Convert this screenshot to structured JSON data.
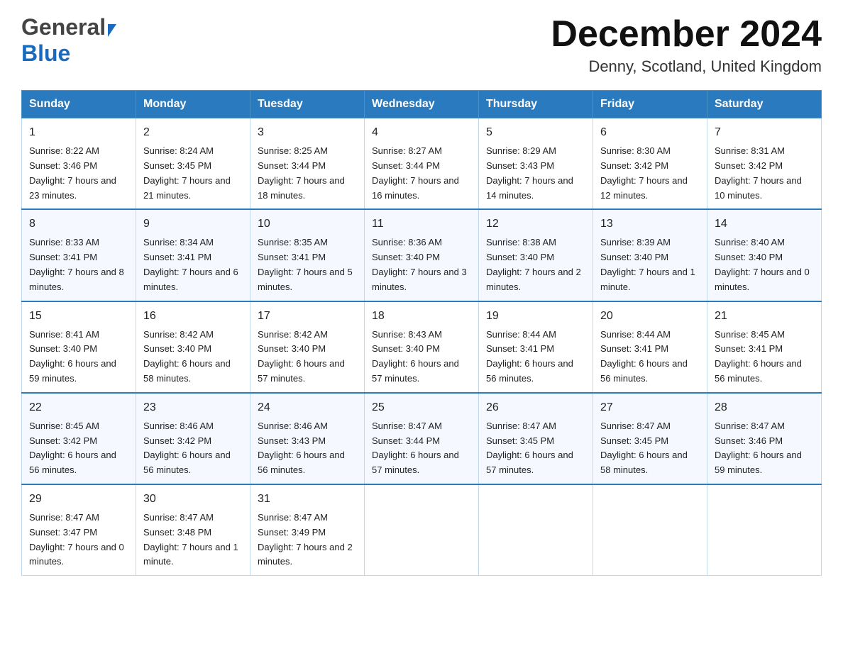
{
  "header": {
    "logo_general": "General",
    "logo_blue": "Blue",
    "title": "December 2024",
    "subtitle": "Denny, Scotland, United Kingdom"
  },
  "days_of_week": [
    "Sunday",
    "Monday",
    "Tuesday",
    "Wednesday",
    "Thursday",
    "Friday",
    "Saturday"
  ],
  "weeks": [
    [
      {
        "day": "1",
        "sunrise": "8:22 AM",
        "sunset": "3:46 PM",
        "daylight": "7 hours and 23 minutes."
      },
      {
        "day": "2",
        "sunrise": "8:24 AM",
        "sunset": "3:45 PM",
        "daylight": "7 hours and 21 minutes."
      },
      {
        "day": "3",
        "sunrise": "8:25 AM",
        "sunset": "3:44 PM",
        "daylight": "7 hours and 18 minutes."
      },
      {
        "day": "4",
        "sunrise": "8:27 AM",
        "sunset": "3:44 PM",
        "daylight": "7 hours and 16 minutes."
      },
      {
        "day": "5",
        "sunrise": "8:29 AM",
        "sunset": "3:43 PM",
        "daylight": "7 hours and 14 minutes."
      },
      {
        "day": "6",
        "sunrise": "8:30 AM",
        "sunset": "3:42 PM",
        "daylight": "7 hours and 12 minutes."
      },
      {
        "day": "7",
        "sunrise": "8:31 AM",
        "sunset": "3:42 PM",
        "daylight": "7 hours and 10 minutes."
      }
    ],
    [
      {
        "day": "8",
        "sunrise": "8:33 AM",
        "sunset": "3:41 PM",
        "daylight": "7 hours and 8 minutes."
      },
      {
        "day": "9",
        "sunrise": "8:34 AM",
        "sunset": "3:41 PM",
        "daylight": "7 hours and 6 minutes."
      },
      {
        "day": "10",
        "sunrise": "8:35 AM",
        "sunset": "3:41 PM",
        "daylight": "7 hours and 5 minutes."
      },
      {
        "day": "11",
        "sunrise": "8:36 AM",
        "sunset": "3:40 PM",
        "daylight": "7 hours and 3 minutes."
      },
      {
        "day": "12",
        "sunrise": "8:38 AM",
        "sunset": "3:40 PM",
        "daylight": "7 hours and 2 minutes."
      },
      {
        "day": "13",
        "sunrise": "8:39 AM",
        "sunset": "3:40 PM",
        "daylight": "7 hours and 1 minute."
      },
      {
        "day": "14",
        "sunrise": "8:40 AM",
        "sunset": "3:40 PM",
        "daylight": "7 hours and 0 minutes."
      }
    ],
    [
      {
        "day": "15",
        "sunrise": "8:41 AM",
        "sunset": "3:40 PM",
        "daylight": "6 hours and 59 minutes."
      },
      {
        "day": "16",
        "sunrise": "8:42 AM",
        "sunset": "3:40 PM",
        "daylight": "6 hours and 58 minutes."
      },
      {
        "day": "17",
        "sunrise": "8:42 AM",
        "sunset": "3:40 PM",
        "daylight": "6 hours and 57 minutes."
      },
      {
        "day": "18",
        "sunrise": "8:43 AM",
        "sunset": "3:40 PM",
        "daylight": "6 hours and 57 minutes."
      },
      {
        "day": "19",
        "sunrise": "8:44 AM",
        "sunset": "3:41 PM",
        "daylight": "6 hours and 56 minutes."
      },
      {
        "day": "20",
        "sunrise": "8:44 AM",
        "sunset": "3:41 PM",
        "daylight": "6 hours and 56 minutes."
      },
      {
        "day": "21",
        "sunrise": "8:45 AM",
        "sunset": "3:41 PM",
        "daylight": "6 hours and 56 minutes."
      }
    ],
    [
      {
        "day": "22",
        "sunrise": "8:45 AM",
        "sunset": "3:42 PM",
        "daylight": "6 hours and 56 minutes."
      },
      {
        "day": "23",
        "sunrise": "8:46 AM",
        "sunset": "3:42 PM",
        "daylight": "6 hours and 56 minutes."
      },
      {
        "day": "24",
        "sunrise": "8:46 AM",
        "sunset": "3:43 PM",
        "daylight": "6 hours and 56 minutes."
      },
      {
        "day": "25",
        "sunrise": "8:47 AM",
        "sunset": "3:44 PM",
        "daylight": "6 hours and 57 minutes."
      },
      {
        "day": "26",
        "sunrise": "8:47 AM",
        "sunset": "3:45 PM",
        "daylight": "6 hours and 57 minutes."
      },
      {
        "day": "27",
        "sunrise": "8:47 AM",
        "sunset": "3:45 PM",
        "daylight": "6 hours and 58 minutes."
      },
      {
        "day": "28",
        "sunrise": "8:47 AM",
        "sunset": "3:46 PM",
        "daylight": "6 hours and 59 minutes."
      }
    ],
    [
      {
        "day": "29",
        "sunrise": "8:47 AM",
        "sunset": "3:47 PM",
        "daylight": "7 hours and 0 minutes."
      },
      {
        "day": "30",
        "sunrise": "8:47 AM",
        "sunset": "3:48 PM",
        "daylight": "7 hours and 1 minute."
      },
      {
        "day": "31",
        "sunrise": "8:47 AM",
        "sunset": "3:49 PM",
        "daylight": "7 hours and 2 minutes."
      },
      null,
      null,
      null,
      null
    ]
  ],
  "labels": {
    "sunrise": "Sunrise:",
    "sunset": "Sunset:",
    "daylight": "Daylight:"
  }
}
